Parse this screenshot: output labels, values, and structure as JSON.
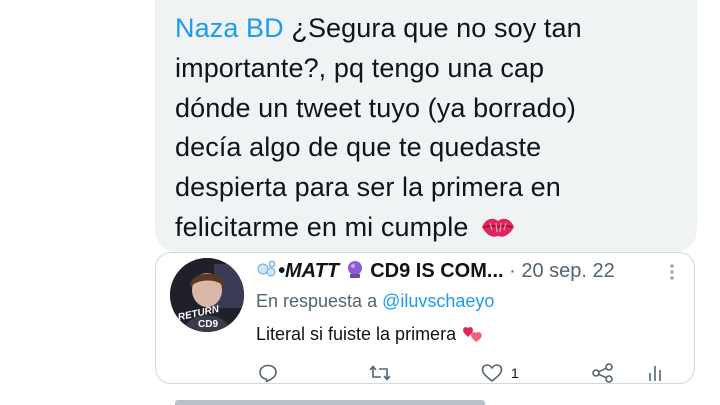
{
  "reply": {
    "mention": "Naza BD",
    "lines": [
      "¿Segura que no soy tan",
      "importante?, pq tengo una cap",
      "dónde un tweet tuyo (ya borrado)",
      "decía algo de que te quedaste",
      "despierta para ser la primera en",
      "felicitarme en mi cumple"
    ],
    "emoji": "kiss-mark-icon"
  },
  "quoted_tweet": {
    "author_prefix": "•",
    "author_name": "MATT",
    "author_suffix": "CD9 IS COM...",
    "date_sep": "·",
    "date": "20 sep. 22",
    "reply_prefix": "En respuesta a",
    "reply_handle": "@iluvschaeyo",
    "text": "Literal si fuiste la primera",
    "avatar_text": "RETURN CD9",
    "actions": {
      "reply_icon": "reply-icon",
      "retweet_icon": "retweet-icon",
      "like_icon": "heart-icon",
      "like_count": "1",
      "share_icon": "share-icon",
      "analytics_icon": "analytics-icon"
    }
  },
  "colors": {
    "mention": "#1d9bf0",
    "bubble_bg": "#eff3f4",
    "muted": "#536471"
  }
}
